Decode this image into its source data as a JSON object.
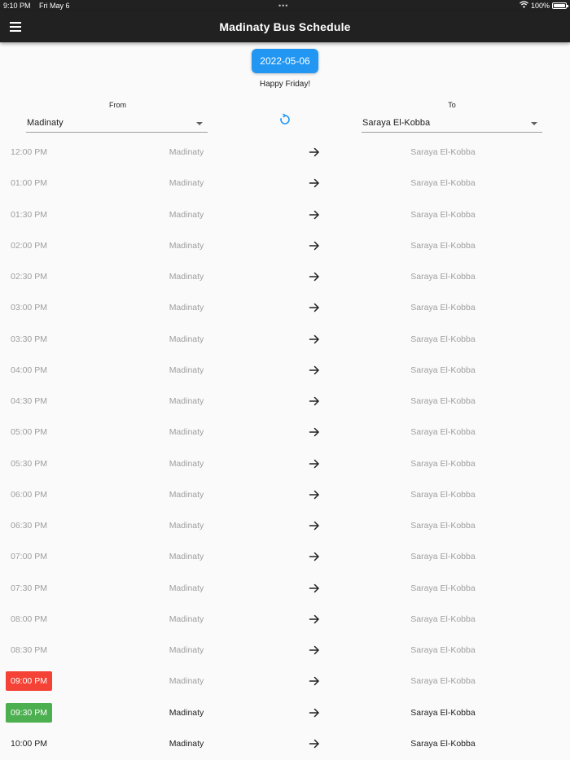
{
  "status_bar": {
    "time": "9:10 PM",
    "date": "Fri May 6",
    "dots": "•••",
    "battery": "100%",
    "wifi_icon": "wifi-icon",
    "battery_icon": "battery-icon"
  },
  "app_bar": {
    "title": "Madinaty Bus Schedule",
    "menu_icon": "menu-icon"
  },
  "date_button": "2022-05-06",
  "greeting": "Happy Friday!",
  "from": {
    "label": "From",
    "selected": "Madinaty"
  },
  "to": {
    "label": "To",
    "selected": "Saraya El-Kobba"
  },
  "swap_icon": "refresh-icon",
  "colors": {
    "accent": "#2196f3",
    "app_bar": "#212121",
    "missed": "#f44336",
    "next": "#4caf50",
    "inactive_text": "#9e9e9e",
    "active_text": "#212121"
  },
  "schedule": [
    {
      "time": "12:00 PM",
      "from": "Madinaty",
      "to": "Saraya El-Kobba",
      "state": "past"
    },
    {
      "time": "01:00 PM",
      "from": "Madinaty",
      "to": "Saraya El-Kobba",
      "state": "past"
    },
    {
      "time": "01:30 PM",
      "from": "Madinaty",
      "to": "Saraya El-Kobba",
      "state": "past"
    },
    {
      "time": "02:00 PM",
      "from": "Madinaty",
      "to": "Saraya El-Kobba",
      "state": "past"
    },
    {
      "time": "02:30 PM",
      "from": "Madinaty",
      "to": "Saraya El-Kobba",
      "state": "past"
    },
    {
      "time": "03:00 PM",
      "from": "Madinaty",
      "to": "Saraya El-Kobba",
      "state": "past"
    },
    {
      "time": "03:30 PM",
      "from": "Madinaty",
      "to": "Saraya El-Kobba",
      "state": "past"
    },
    {
      "time": "04:00 PM",
      "from": "Madinaty",
      "to": "Saraya El-Kobba",
      "state": "past"
    },
    {
      "time": "04:30 PM",
      "from": "Madinaty",
      "to": "Saraya El-Kobba",
      "state": "past"
    },
    {
      "time": "05:00 PM",
      "from": "Madinaty",
      "to": "Saraya El-Kobba",
      "state": "past"
    },
    {
      "time": "05:30 PM",
      "from": "Madinaty",
      "to": "Saraya El-Kobba",
      "state": "past"
    },
    {
      "time": "06:00 PM",
      "from": "Madinaty",
      "to": "Saraya El-Kobba",
      "state": "past"
    },
    {
      "time": "06:30 PM",
      "from": "Madinaty",
      "to": "Saraya El-Kobba",
      "state": "past"
    },
    {
      "time": "07:00 PM",
      "from": "Madinaty",
      "to": "Saraya El-Kobba",
      "state": "past"
    },
    {
      "time": "07:30 PM",
      "from": "Madinaty",
      "to": "Saraya El-Kobba",
      "state": "past"
    },
    {
      "time": "08:00 PM",
      "from": "Madinaty",
      "to": "Saraya El-Kobba",
      "state": "past"
    },
    {
      "time": "08:30 PM",
      "from": "Madinaty",
      "to": "Saraya El-Kobba",
      "state": "past"
    },
    {
      "time": "09:00 PM",
      "from": "Madinaty",
      "to": "Saraya El-Kobba",
      "state": "missed"
    },
    {
      "time": "09:30 PM",
      "from": "Madinaty",
      "to": "Saraya El-Kobba",
      "state": "next"
    },
    {
      "time": "10:00 PM",
      "from": "Madinaty",
      "to": "Saraya El-Kobba",
      "state": "upcoming"
    }
  ]
}
